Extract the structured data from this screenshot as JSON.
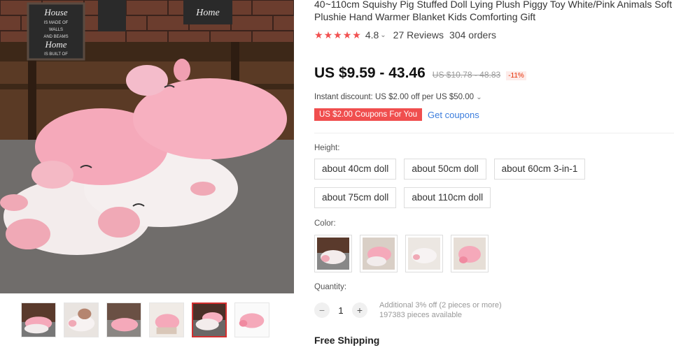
{
  "product": {
    "title": "40~110cm Squishy Pig Stuffed Doll Lying Plush Piggy Toy White/Pink Animals Soft Plushie Hand Warmer Blanket Kids Comforting Gift",
    "rating": "4.8",
    "reviews": "27 Reviews",
    "orders": "304 orders",
    "price": "US $9.59 - 43.46",
    "old_price": "US $10.78 - 48.83",
    "discount": "-11%",
    "instant_discount": "Instant discount: US $2.00 off per US $50.00",
    "coupon_badge": "US $2.00 Coupons For You",
    "get_coupons": "Get coupons"
  },
  "image_sign": {
    "line1": "House",
    "line2": "IS MADE OF",
    "line3": "WALLS",
    "line4": "AND BEAMS",
    "line5": "Home",
    "line6": "IS BUILT OF",
    "right": "Home"
  },
  "height": {
    "label": "Height:",
    "options": [
      "about 40cm doll",
      "about 50cm doll",
      "about 60cm 3-in-1",
      "about 75cm doll",
      "about 110cm doll"
    ]
  },
  "color": {
    "label": "Color:"
  },
  "quantity": {
    "label": "Quantity:",
    "value": "1",
    "minus": "−",
    "plus": "+",
    "offer": "Additional 3% off (2 pieces or more)",
    "available": "197383 pieces available"
  },
  "shipping": "Free Shipping",
  "colors": {
    "accent": "#f04e4e",
    "link": "#3b7ddd",
    "star": "#f25050"
  },
  "icons": {
    "star": "star-icon",
    "chevron": "chevron-down-icon"
  }
}
